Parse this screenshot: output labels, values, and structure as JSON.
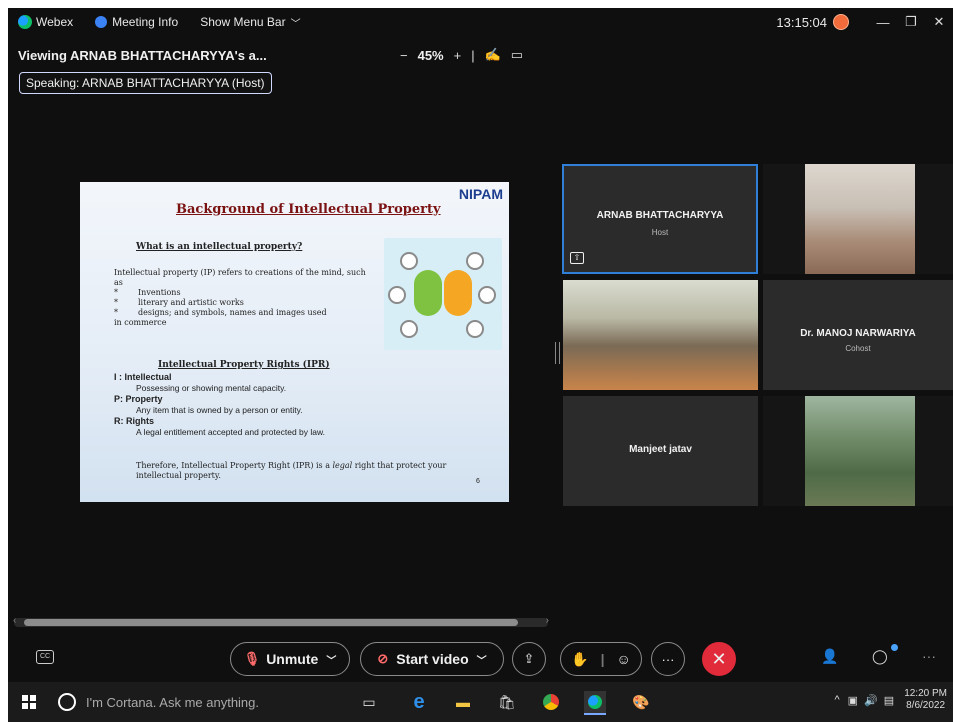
{
  "topbar": {
    "app_name": "Webex",
    "meeting_info": "Meeting Info",
    "show_menu_bar": "Show Menu Bar",
    "clock": "13:15:04"
  },
  "viewbar": {
    "title": "Viewing ARNAB BHATTACHARYYA's a...",
    "zoom_minus": "−",
    "zoom_level": "45%",
    "zoom_plus": "+"
  },
  "speaking": "Speaking: ARNAB BHATTACHARYYA (Host)",
  "slide": {
    "logo": "NIPAM",
    "title": "Background of Intellectual Property",
    "question": "What is an intellectual property?",
    "intro": "Intellectual property (IP) refers to creations of the mind, such as",
    "bullets": [
      "Inventions",
      "literary and artistic works",
      "designs; and symbols, names and images used"
    ],
    "intro_tail": "in commerce",
    "ipr_heading": "Intellectual Property Rights (IPR)",
    "defs": [
      {
        "term": "I : Intellectual",
        "meaning": "Possessing or showing mental capacity."
      },
      {
        "term": "P: Property",
        "meaning": "Any item that is owned by a person or entity."
      },
      {
        "term": "R: Rights",
        "meaning": "A legal entitlement accepted and protected by law."
      }
    ],
    "footer_before": "Therefore, Intellectual Property Right (IPR) is a ",
    "footer_italic": "legal",
    "footer_after": " right that protect your intellectual property.",
    "page_number": "6"
  },
  "participants": [
    {
      "name": "ARNAB BHATTACHARYYA",
      "role": "Host"
    },
    {
      "name": "",
      "role": ""
    },
    {
      "name": "",
      "role": ""
    },
    {
      "name": "Dr. MANOJ NARWARIYA",
      "role": "Cohost"
    },
    {
      "name": "Manjeet jatav",
      "role": ""
    },
    {
      "name": "",
      "role": ""
    }
  ],
  "controls": {
    "unmute": "Unmute",
    "start_video": "Start video"
  },
  "taskbar": {
    "cortana_placeholder": "I'm Cortana. Ask me anything.",
    "time": "12:20 PM",
    "date": "8/6/2022"
  },
  "colors": {
    "end_call": "#e12a3a",
    "active_border": "#2f7fd8",
    "recording": "#f26b3a",
    "slide_title": "#7a1212"
  }
}
